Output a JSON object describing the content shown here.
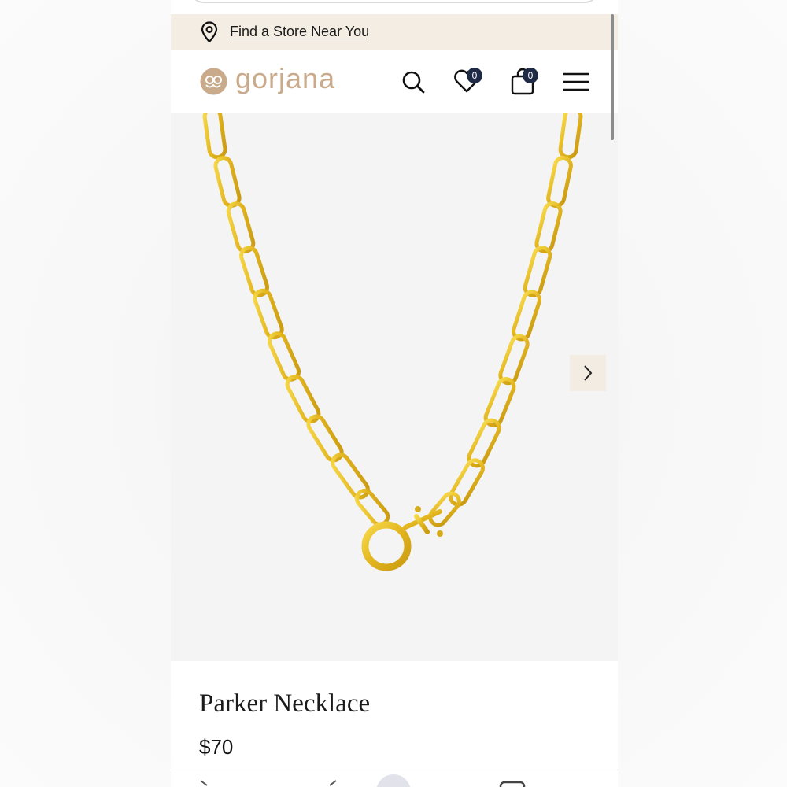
{
  "store_bar": {
    "link_text": "Find a Store Near You",
    "icon": "map-pin-icon"
  },
  "header": {
    "logo_text": "gorjana",
    "logo_icon": "gorjana-logo-mark",
    "wishlist_count": "0",
    "cart_count": "0",
    "icons": [
      "search-icon",
      "heart-icon",
      "shopping-bag-icon",
      "hamburger-menu-icon"
    ]
  },
  "gallery": {
    "next_icon": "chevron-right-icon"
  },
  "product": {
    "name": "Parker Necklace",
    "price": "$70"
  },
  "colors": {
    "brand": "#c9aa8b",
    "store_bar_bg": "#f3ede3",
    "badge": "#1f2a44",
    "gold": "#e8bf2a"
  }
}
